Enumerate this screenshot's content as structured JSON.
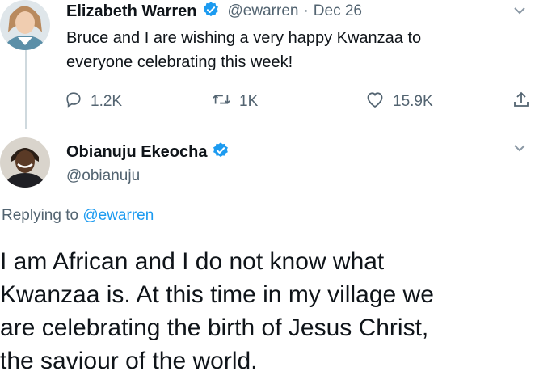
{
  "tweet1": {
    "author": "Elizabeth Warren",
    "handle": "@ewarren",
    "separator": "·",
    "date": "Dec 26",
    "text_line1": "Bruce and I are wishing a very happy Kwanzaa to",
    "text_line2": "everyone celebrating this week!",
    "replies": "1.2K",
    "retweets": "1K",
    "likes": "15.9K"
  },
  "tweet2": {
    "author": "Obianuju Ekeocha",
    "handle": "@obianuju",
    "replying_prefix": "Replying to",
    "replying_to": "@ewarren",
    "text_lines": [
      "I am African and I do not know what",
      "Kwanzaa is. At this time in my village we",
      "are celebrating the birth of Jesus Christ,",
      "the saviour of the world."
    ]
  },
  "colors": {
    "verified": "#1d9bf0",
    "link": "#1d9bf0",
    "secondary": "#536471",
    "thread_line": "#cfd9de"
  },
  "icons": [
    "verified-badge-icon",
    "reply-icon",
    "retweet-icon",
    "like-icon",
    "share-icon",
    "chevron-down-icon"
  ]
}
